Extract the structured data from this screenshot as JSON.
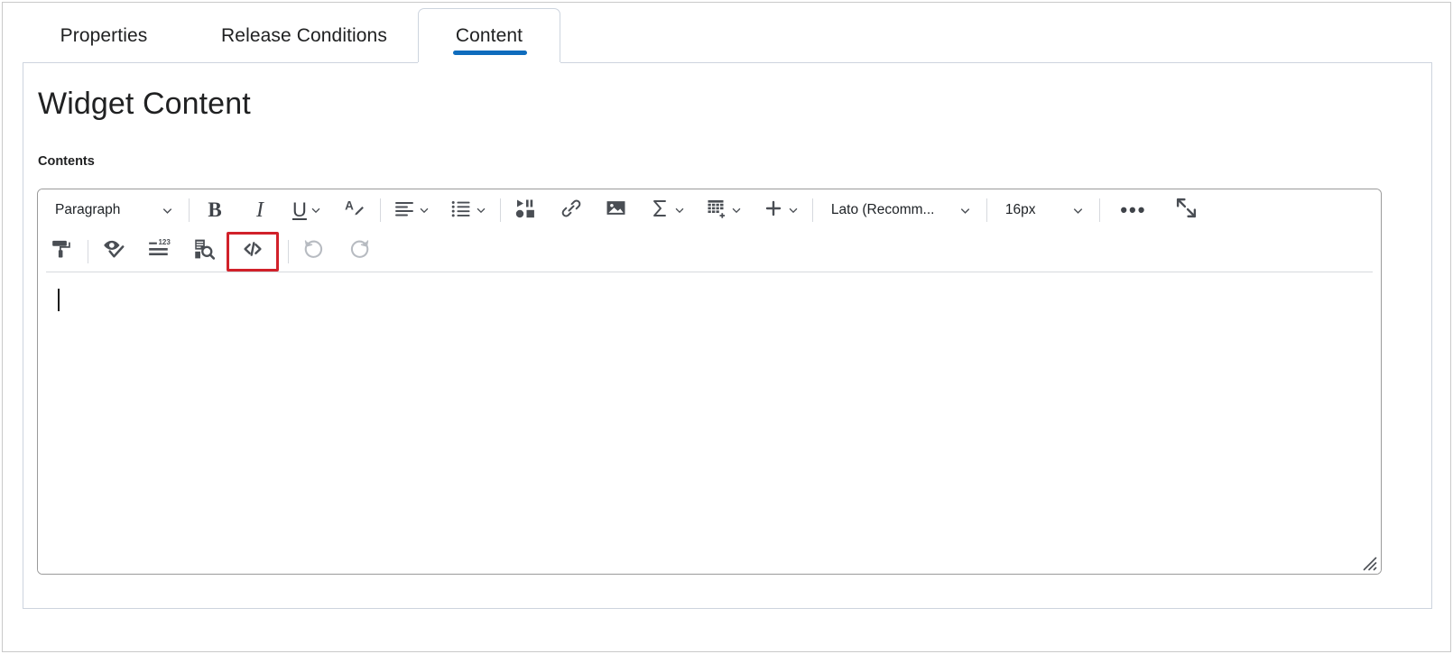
{
  "tabs": [
    {
      "label": "Properties",
      "active": false,
      "name": "tab-properties"
    },
    {
      "label": "Release Conditions",
      "active": false,
      "name": "tab-release-conditions"
    },
    {
      "label": "Content",
      "active": true,
      "name": "tab-content"
    }
  ],
  "page": {
    "title": "Widget Content",
    "field_label": "Contents"
  },
  "editor": {
    "body_text": "",
    "caret_visible": true,
    "toolbar": {
      "row1": {
        "paragraph_style": {
          "value": "Paragraph",
          "icon": "chevron-down-icon"
        },
        "bold": {
          "label": "B",
          "icon": "bold-icon"
        },
        "italic": {
          "label": "I",
          "icon": "italic-icon"
        },
        "underline": {
          "label": "U",
          "icon": "underline-icon"
        },
        "text_color": {
          "icon": "text-color-icon"
        },
        "align": {
          "icon": "align-left-icon"
        },
        "list": {
          "icon": "bulleted-list-icon"
        },
        "media": {
          "icon": "insert-media-icon"
        },
        "link": {
          "icon": "link-icon"
        },
        "image": {
          "icon": "image-icon"
        },
        "equation": {
          "icon": "sigma-equation-icon"
        },
        "table": {
          "icon": "insert-table-icon"
        },
        "insert": {
          "icon": "plus-icon"
        },
        "font_family": {
          "value": "Lato (Recomm...",
          "icon": "chevron-down-icon"
        },
        "font_size": {
          "value": "16px",
          "icon": "chevron-down-icon"
        },
        "more_options": {
          "icon": "ellipsis-icon"
        },
        "fullscreen": {
          "icon": "fullscreen-expand-icon"
        }
      },
      "row2": {
        "format_painter": {
          "icon": "paint-roller-icon"
        },
        "accessibility_checker": {
          "icon": "accessibility-check-icon"
        },
        "word_count": {
          "icon": "word-count-icon"
        },
        "preview": {
          "icon": "preview-search-icon"
        },
        "html_source": {
          "icon": "code-source-icon",
          "highlighted": true
        },
        "undo": {
          "icon": "undo-icon",
          "disabled": true
        },
        "redo": {
          "icon": "redo-icon",
          "disabled": true
        }
      }
    },
    "resize_handle": {
      "icon": "resize-grip-icon"
    }
  },
  "colors": {
    "accent_blue": "#0f6cbd",
    "highlight_red": "#d1212a",
    "icon_grey": "#4a4e54",
    "disabled_grey": "#b7bbc1",
    "border_grey": "#cdd4de",
    "text_dark": "#202122"
  }
}
